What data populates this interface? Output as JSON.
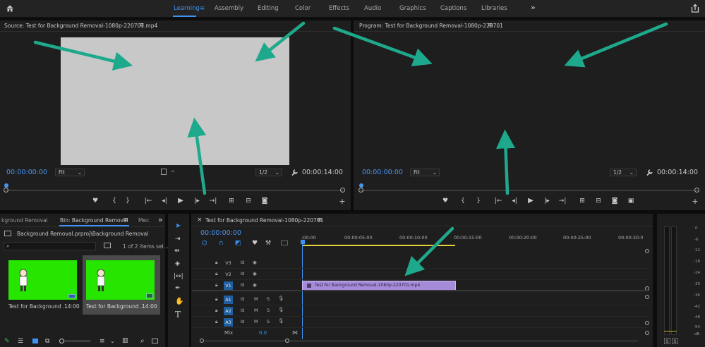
{
  "workspaces": {
    "items": [
      "Learning",
      "Assembly",
      "Editing",
      "Color",
      "Effects",
      "Audio",
      "Graphics",
      "Captions",
      "Libraries"
    ],
    "active": "Learning",
    "overflow": "»"
  },
  "source_monitor": {
    "title": "Source: Test for Background Removal-1080p-220701.mp4",
    "menu": "≡",
    "timecode": "00:00:00:00",
    "fit": "Fit",
    "resolution": "1/2",
    "duration": "00:00:14:00"
  },
  "program_monitor": {
    "title": "Program: Test for Background Removal-1080p-220701",
    "menu": "≡",
    "timecode": "00:00:00:00",
    "fit": "Fit",
    "resolution": "1/2",
    "duration": "00:00:14:00"
  },
  "project_panel": {
    "tab_prev": "kground Removal",
    "tab_active": "Bin: Background Removal",
    "tab_active_menu": "≡",
    "tab_next": "Mec",
    "overflow": "»",
    "path": "Background Removal.prproj\\Background Removal",
    "items_selected": "1 of 2 items sel...",
    "clips": [
      {
        "name": "Test for Background ...",
        "duration": "14:00"
      },
      {
        "name": "Test for Background ...",
        "duration": "14:00"
      }
    ]
  },
  "timeline": {
    "title": "Test for Background Removal-1080p-220701",
    "menu": "≡",
    "close": "×",
    "timecode": "00:00:00:00",
    "ruler_labels": [
      ":00:00",
      "00:00:05:00",
      "00:00:10:00",
      "00:00:15:00",
      "00:00:20:00",
      "00:00:25:00",
      "00:00:30:0"
    ],
    "video_tracks": [
      "V3",
      "V2",
      "V1"
    ],
    "audio_tracks": [
      "A1",
      "A2",
      "A3"
    ],
    "mute": "M",
    "solo": "S",
    "mix_label": "Mix",
    "mix_value": "0.0",
    "clip_name": "Test for Background Removal-1080p-220701.mp4"
  },
  "audio_meter": {
    "db_labels": [
      "0",
      "-6",
      "-12",
      "-18",
      "-24",
      "-30",
      "-36",
      "-42",
      "-48",
      "-54",
      "dB"
    ],
    "solo_buttons": [
      "S",
      "S"
    ]
  },
  "colors": {
    "accent": "#3d93f5",
    "clip_purple": "#a68cd8",
    "arrow": "#1fa98c",
    "green_screen": "#26e600"
  }
}
